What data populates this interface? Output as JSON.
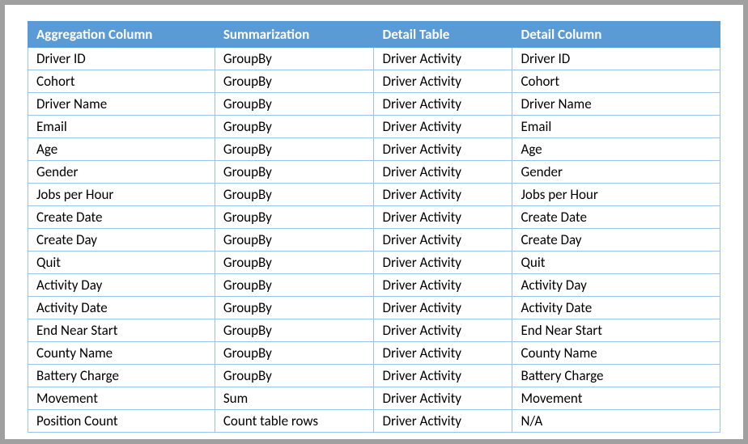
{
  "table": {
    "headers": {
      "aggregation_column": "Aggregation Column",
      "summarization": "Summarization",
      "detail_table": "Detail Table",
      "detail_column": "Detail Column"
    },
    "rows": [
      {
        "aggregation_column": "Driver ID",
        "summarization": "GroupBy",
        "detail_table": "Driver Activity",
        "detail_column": "Driver ID"
      },
      {
        "aggregation_column": "Cohort",
        "summarization": "GroupBy",
        "detail_table": "Driver Activity",
        "detail_column": "Cohort"
      },
      {
        "aggregation_column": "Driver Name",
        "summarization": "GroupBy",
        "detail_table": "Driver Activity",
        "detail_column": "Driver Name"
      },
      {
        "aggregation_column": "Email",
        "summarization": "GroupBy",
        "detail_table": "Driver Activity",
        "detail_column": "Email"
      },
      {
        "aggregation_column": "Age",
        "summarization": "GroupBy",
        "detail_table": "Driver Activity",
        "detail_column": "Age"
      },
      {
        "aggregation_column": "Gender",
        "summarization": "GroupBy",
        "detail_table": "Driver Activity",
        "detail_column": "Gender"
      },
      {
        "aggregation_column": "Jobs per Hour",
        "summarization": "GroupBy",
        "detail_table": "Driver Activity",
        "detail_column": "Jobs per Hour"
      },
      {
        "aggregation_column": "Create Date",
        "summarization": "GroupBy",
        "detail_table": "Driver Activity",
        "detail_column": "Create Date"
      },
      {
        "aggregation_column": "Create Day",
        "summarization": "GroupBy",
        "detail_table": "Driver Activity",
        "detail_column": "Create Day"
      },
      {
        "aggregation_column": "Quit",
        "summarization": "GroupBy",
        "detail_table": "Driver Activity",
        "detail_column": "Quit"
      },
      {
        "aggregation_column": "Activity Day",
        "summarization": "GroupBy",
        "detail_table": "Driver Activity",
        "detail_column": "Activity Day"
      },
      {
        "aggregation_column": "Activity Date",
        "summarization": "GroupBy",
        "detail_table": "Driver Activity",
        "detail_column": "Activity Date"
      },
      {
        "aggregation_column": "End Near Start",
        "summarization": "GroupBy",
        "detail_table": "Driver Activity",
        "detail_column": "End Near Start"
      },
      {
        "aggregation_column": "County Name",
        "summarization": "GroupBy",
        "detail_table": "Driver Activity",
        "detail_column": "County Name"
      },
      {
        "aggregation_column": "Battery Charge",
        "summarization": "GroupBy",
        "detail_table": "Driver Activity",
        "detail_column": "Battery Charge"
      },
      {
        "aggregation_column": "Movement",
        "summarization": "Sum",
        "detail_table": "Driver Activity",
        "detail_column": "Movement"
      },
      {
        "aggregation_column": "Position Count",
        "summarization": "Count table rows",
        "detail_table": "Driver Activity",
        "detail_column": "N/A"
      }
    ]
  }
}
